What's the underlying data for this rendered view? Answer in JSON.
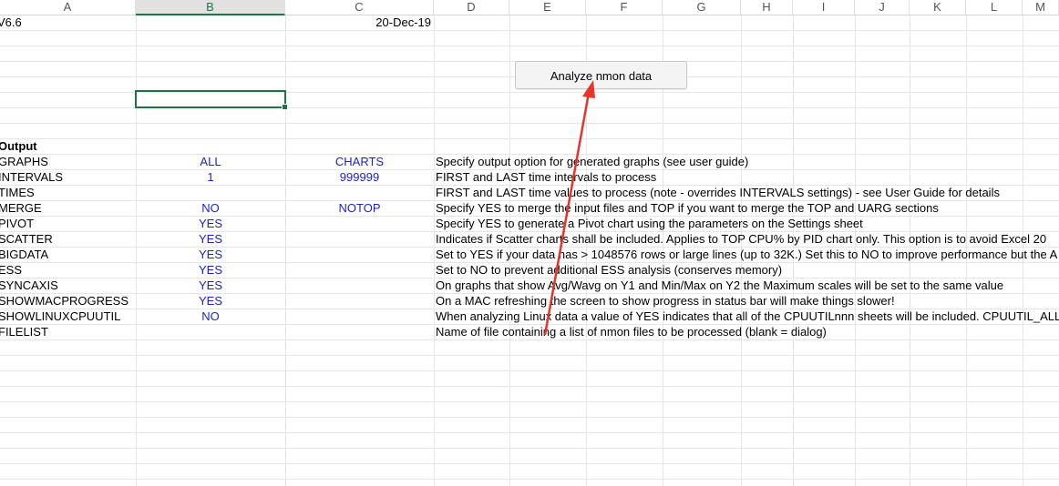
{
  "columns": [
    "A",
    "B",
    "C",
    "D",
    "E",
    "F",
    "G",
    "H",
    "I",
    "J",
    "K",
    "L",
    "M"
  ],
  "header": {
    "version": "V6.6",
    "date": "20-Dec-19"
  },
  "button": {
    "label": "Analyze nmon data"
  },
  "section_title": "Output",
  "settings": [
    {
      "name": "GRAPHS",
      "b": "ALL",
      "c": "CHARTS",
      "desc": "Specify output option for generated graphs (see user guide)"
    },
    {
      "name": "INTERVALS",
      "b": "1",
      "c": "999999",
      "desc": "FIRST and LAST time intervals to process"
    },
    {
      "name": "TIMES",
      "b": "",
      "c": "",
      "desc": "FIRST and LAST time values to process (note - overrides INTERVALS settings) - see User Guide for details"
    },
    {
      "name": "MERGE",
      "b": "NO",
      "c": "NOTOP",
      "desc": "Specify YES to merge the input files and TOP if you want to merge the TOP and UARG sections"
    },
    {
      "name": "PIVOT",
      "b": "YES",
      "c": "",
      "desc": "Specify YES to generate a Pivot chart using the parameters on the Settings sheet"
    },
    {
      "name": "SCATTER",
      "b": "YES",
      "c": "",
      "desc": "Indicates if Scatter charts shall be included.  Applies to TOP CPU% by PID chart only.  This option is to avoid Excel 20"
    },
    {
      "name": "BIGDATA",
      "b": "YES",
      "c": "",
      "desc": "Set to YES if your data has > 1048576 rows or large lines (up to 32K.)  Set this to NO to improve performance but the A"
    },
    {
      "name": "ESS",
      "b": "YES",
      "c": "",
      "desc": "Set to NO to prevent additional ESS analysis (conserves memory)"
    },
    {
      "name": "SYNCAXIS",
      "b": "YES",
      "c": "",
      "desc": "On graphs that show Avg/Wavg on Y1 and Min/Max on Y2 the Maximum scales will be set to the same value"
    },
    {
      "name": "SHOWMACPROGRESS",
      "b": "YES",
      "c": "",
      "desc": "On a MAC refreshing the screen to show progress in status bar will make things slower!"
    },
    {
      "name": "SHOWLINUXCPUUTIL",
      "b": "NO",
      "c": "",
      "desc": "When analyzing Linux data a value of YES indicates that all of the CPUUTILnnn sheets will be included.  CPUUTIL_ALL"
    },
    {
      "name": "FILELIST",
      "b": "",
      "c": "",
      "desc": "Name of file containing a list of nmon files to be processed (blank = dialog)"
    }
  ],
  "colors": {
    "value_blue": "#1f22cc",
    "selection_green": "#217346",
    "arrow_red": "#e8352b"
  }
}
